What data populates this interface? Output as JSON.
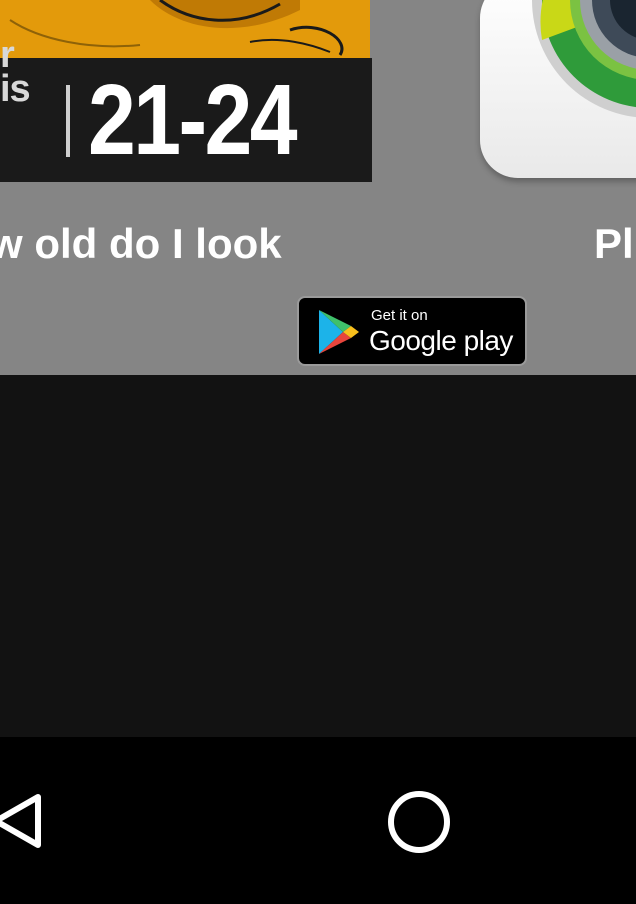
{
  "promo": {
    "left_app": {
      "banner_prefix_top": "r",
      "banner_prefix": "is",
      "banner_age": "21-24",
      "title": "w old do I look"
    },
    "right_app": {
      "title": "Pl"
    },
    "store_badge": {
      "small_text": "Get it on",
      "big_text": "Google play"
    }
  },
  "navigation": {
    "back": "back-icon",
    "home": "home-icon"
  },
  "colors": {
    "promo_background": "#858585",
    "photo_background": "#e39a0b",
    "content_background": "#121212",
    "navbar_background": "#000000"
  }
}
